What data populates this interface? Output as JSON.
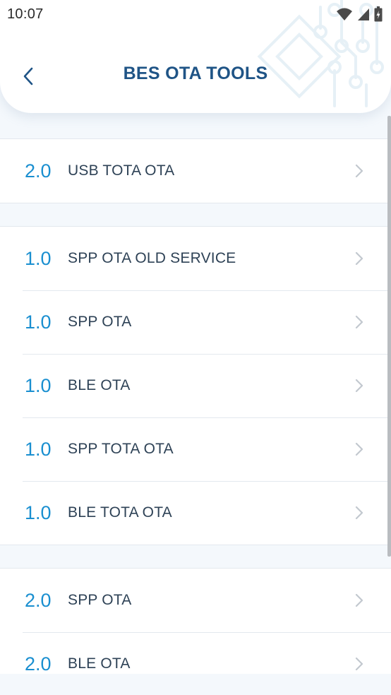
{
  "status_bar": {
    "time": "10:07",
    "icons": [
      "wifi-icon",
      "cell-signal-icon",
      "battery-icon"
    ]
  },
  "header": {
    "title": "BES OTA TOOLS",
    "back_icon": "back-arrow-icon"
  },
  "groups": [
    {
      "rows": [
        {
          "version": "2.0",
          "label": "USB TOTA OTA"
        }
      ]
    },
    {
      "rows": [
        {
          "version": "1.0",
          "label": "SPP OTA OLD SERVICE"
        },
        {
          "version": "1.0",
          "label": "SPP OTA"
        },
        {
          "version": "1.0",
          "label": "BLE OTA"
        },
        {
          "version": "1.0",
          "label": "SPP TOTA OTA"
        },
        {
          "version": "1.0",
          "label": "BLE TOTA OTA"
        }
      ]
    },
    {
      "rows": [
        {
          "version": "2.0",
          "label": "SPP OTA"
        },
        {
          "version": "2.0",
          "label": "BLE OTA"
        }
      ]
    }
  ],
  "colors": {
    "title": "#1f5486",
    "version": "#1a8fd0",
    "label": "#2e4256",
    "background": "#f4f8fc",
    "divider": "#e3e8ee"
  }
}
